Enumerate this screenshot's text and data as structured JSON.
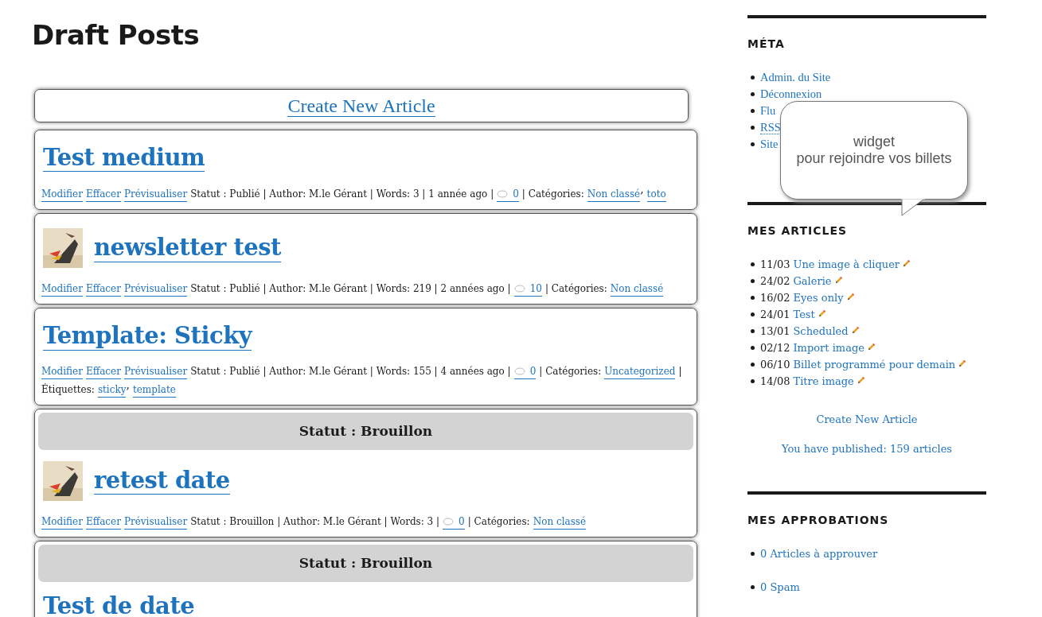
{
  "page_title": "Draft Posts",
  "create_button": "Create New Article",
  "posts": [
    {
      "title": "Test medium",
      "thumbnail": false,
      "meta": [
        {
          "kind": "link",
          "text": "Modifier"
        },
        {
          "kind": "link",
          "text": "Effacer"
        },
        {
          "kind": "link",
          "text": "Prévisualiser"
        },
        {
          "kind": "text",
          "text": "Statut : Publié | Author: M.le Gérant | Words: 3 | 1 année ago |"
        },
        {
          "kind": "comments",
          "text": "0"
        },
        {
          "kind": "text",
          "text": "| Catégories:"
        },
        {
          "kind": "link",
          "text": "Non classé"
        },
        {
          "kind": "separator",
          "text": ","
        },
        {
          "kind": "link",
          "text": "toto"
        }
      ]
    },
    {
      "title": "newsletter test",
      "thumbnail": true,
      "meta": [
        {
          "kind": "link",
          "text": "Modifier"
        },
        {
          "kind": "link",
          "text": "Effacer"
        },
        {
          "kind": "link",
          "text": "Prévisualiser"
        },
        {
          "kind": "text",
          "text": "Statut : Publié | Author: M.le Gérant | Words: 219 | 2 années ago |"
        },
        {
          "kind": "comments",
          "text": "10"
        },
        {
          "kind": "text",
          "text": "| Catégories:"
        },
        {
          "kind": "link",
          "text": "Non classé"
        }
      ]
    },
    {
      "title": "Template: Sticky",
      "thumbnail": false,
      "meta": [
        {
          "kind": "link",
          "text": "Modifier"
        },
        {
          "kind": "link",
          "text": "Effacer"
        },
        {
          "kind": "link",
          "text": "Prévisualiser"
        },
        {
          "kind": "text",
          "text": "Statut : Publié | Author: M.le Gérant | Words: 155 | 4 années ago |"
        },
        {
          "kind": "comments",
          "text": "0"
        },
        {
          "kind": "text",
          "text": "| Catégories:"
        },
        {
          "kind": "link",
          "text": "Uncategorized"
        },
        {
          "kind": "text",
          "text": "|"
        },
        {
          "kind": "text",
          "text": "Étiquettes:"
        },
        {
          "kind": "link",
          "text": "sticky"
        },
        {
          "kind": "separator",
          "text": ","
        },
        {
          "kind": "link",
          "text": "template"
        }
      ]
    },
    {
      "title": "retest date",
      "thumbnail": true,
      "banner": "Statut : Brouillon",
      "meta": [
        {
          "kind": "link",
          "text": "Modifier"
        },
        {
          "kind": "link",
          "text": "Effacer"
        },
        {
          "kind": "link",
          "text": "Prévisualiser"
        },
        {
          "kind": "text",
          "text": "Statut : Brouillon | Author: M.le Gérant | Words: 3 |"
        },
        {
          "kind": "comments",
          "text": "0"
        },
        {
          "kind": "text",
          "text": "| Catégories:"
        },
        {
          "kind": "link",
          "text": "Non classé"
        }
      ]
    },
    {
      "title": "Test de date",
      "thumbnail": false,
      "banner": "Statut : Brouillon"
    }
  ],
  "sidebar": {
    "meta": {
      "heading": "MÉTA",
      "links": [
        "Admin. du Site",
        "Déconnexion",
        "Flu",
        "RSS",
        "Site"
      ]
    },
    "tooltip": {
      "lines": [
        "widget",
        "pour rejoindre vos billets"
      ]
    },
    "articles": {
      "heading": "MES ARTICLES",
      "items": [
        {
          "date": "11/03",
          "title": "Une image à cliquer"
        },
        {
          "date": "24/02",
          "title": "Galerie"
        },
        {
          "date": "16/02",
          "title": "Eyes only"
        },
        {
          "date": "24/01",
          "title": "Test"
        },
        {
          "date": "13/01",
          "title": "Scheduled"
        },
        {
          "date": "02/12",
          "title": "Import image"
        },
        {
          "date": "06/10",
          "title": "Billet programmé pour demain"
        },
        {
          "date": "14/08",
          "title": "Titre image"
        }
      ],
      "create_link": "Create New Article",
      "published": "You have published: 159 articles"
    },
    "approvals": {
      "heading": "MES APPROBATIONS",
      "links": [
        "0 Articles à approuver",
        "0 Spam"
      ]
    }
  }
}
